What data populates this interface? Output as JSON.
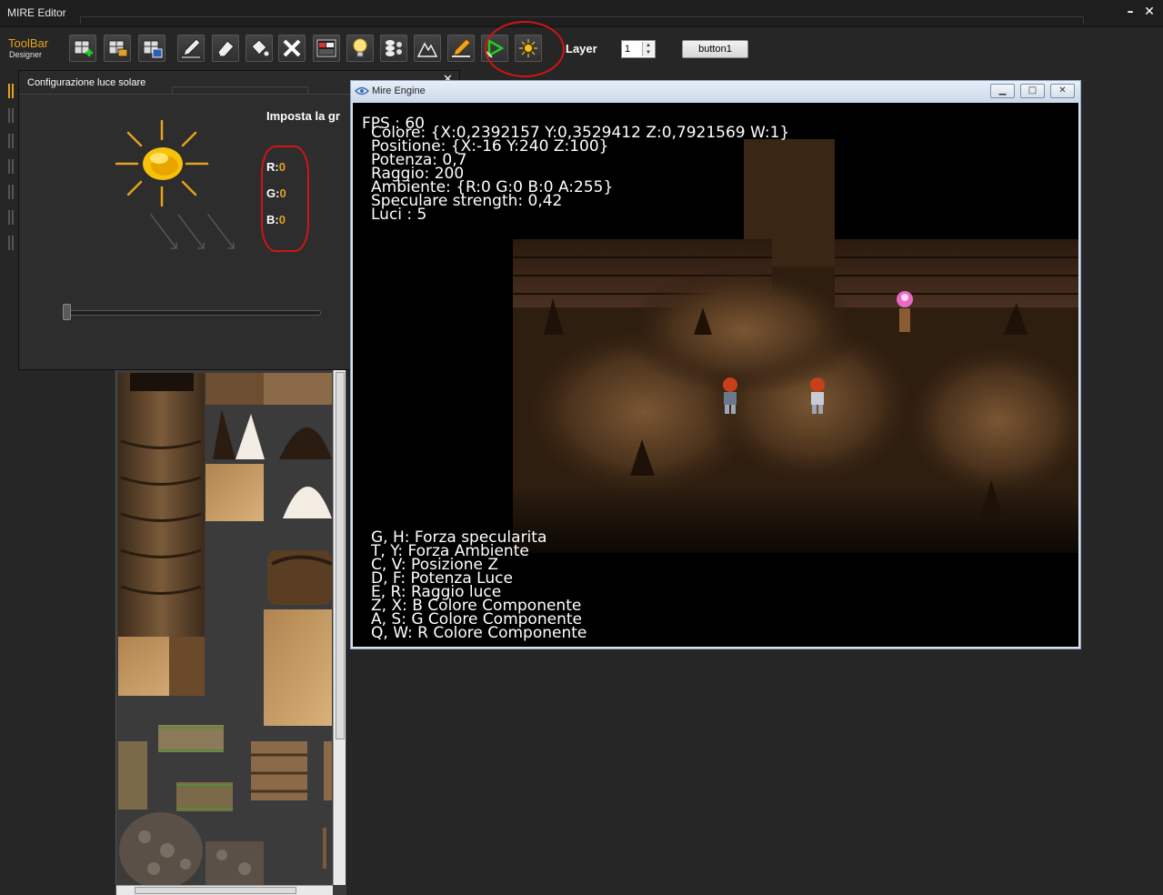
{
  "app": {
    "title": "MIRE Editor"
  },
  "toolbar": {
    "title": "ToolBar",
    "subtitle": "Designer",
    "layer_label": "Layer",
    "layer_value": "1",
    "button1_label": "button1",
    "buttons": [
      {
        "icon": "new-map-icon"
      },
      {
        "icon": "open-map-icon"
      },
      {
        "icon": "save-map-icon"
      },
      {
        "icon": "pencil-icon"
      },
      {
        "icon": "eraser-icon"
      },
      {
        "icon": "fill-bucket-icon"
      },
      {
        "icon": "delete-icon"
      },
      {
        "icon": "tileset-icon"
      },
      {
        "icon": "light-bulb-icon"
      },
      {
        "icon": "layers-icon"
      },
      {
        "icon": "terrain-icon"
      },
      {
        "icon": "edit-pencil-icon"
      },
      {
        "icon": "play-icon"
      },
      {
        "icon": "sun-light-icon"
      }
    ]
  },
  "sun_dialog": {
    "title": "Configurazione luce solare",
    "heading": "Imposta la gr",
    "r_label": "R:",
    "r_value": "0",
    "g_label": "G:",
    "g_value": "0",
    "b_label": "B:",
    "b_value": "0",
    "intensity": 0
  },
  "engine": {
    "window_title": "Mire Engine",
    "fps": "FPS : 60",
    "info_lines": [
      "Colore: {X:0,2392157 Y:0,3529412 Z:0,7921569 W:1}",
      "Positione: {X:-16 Y:240 Z:100}",
      "Potenza: 0,7",
      "Raggio: 200",
      "Ambiente: {R:0 G:0 B:0 A:255}",
      "Speculare strength: 0,42",
      "Luci : 5"
    ],
    "help_lines": [
      "G, H: Forza specularita",
      "T, Y: Forza Ambiente",
      "C, V: Posizione Z",
      "D, F: Potenza Luce",
      "E, R: Raggio luce",
      "Z, X: B Colore Componente",
      "A, S: G Colore Componente",
      "Q, W: R Colore Componente"
    ]
  },
  "colors": {
    "accent": "#e4a21e",
    "highlight": "#d21414"
  }
}
